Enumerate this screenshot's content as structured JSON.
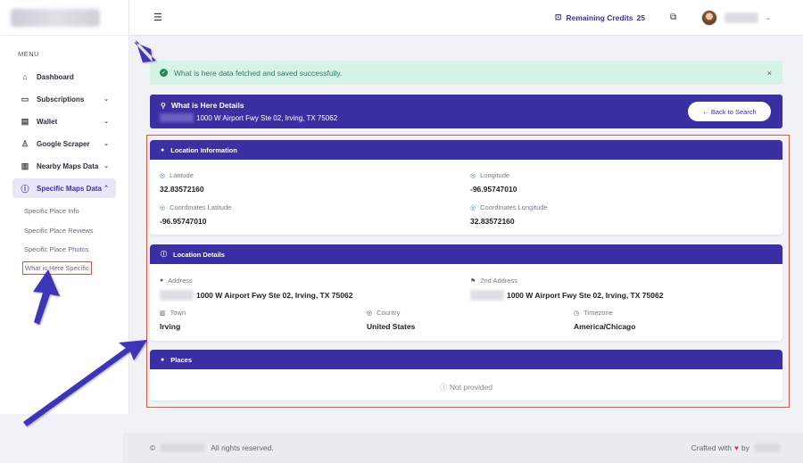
{
  "sidebar": {
    "menu_label": "MENU",
    "items": [
      {
        "label": "Dashboard",
        "icon": "home-icon",
        "glyph": "⌂",
        "chev": ""
      },
      {
        "label": "Subscriptions",
        "icon": "card-icon",
        "glyph": "▭",
        "chev": "⌄"
      },
      {
        "label": "Wallet",
        "icon": "wallet-icon",
        "glyph": "▤",
        "chev": "⌄"
      },
      {
        "label": "Google Scraper",
        "icon": "user-icon",
        "glyph": "♙",
        "chev": "⌄"
      },
      {
        "label": "Nearby Maps Data",
        "icon": "book-icon",
        "glyph": "▥",
        "chev": "⌄"
      },
      {
        "label": "Specific Maps Data",
        "icon": "info-icon",
        "glyph": "ⓘ",
        "chev": "⌃"
      }
    ],
    "sub_items": [
      "Specific Place Info",
      "Specific Place Reviews",
      "Specific Place Photos",
      "What is Here Specific"
    ]
  },
  "topbar": {
    "credits_label": "Remaining Credits",
    "credits_value": "25"
  },
  "alert": {
    "message": "What is here data fetched and saved successfully.",
    "close": "×"
  },
  "details": {
    "title": "What is Here Details",
    "address": "1000 W Airport Fwy Ste 02, Irving, TX 75062",
    "back_button": "← Back to Search"
  },
  "location_info": {
    "header": "Location Information",
    "latitude_label": "Latitude",
    "latitude_value": "32.83572160",
    "longitude_label": "Longitude",
    "longitude_value": "-96.95747010",
    "coord_lat_label": "Coordinates Latitude",
    "coord_lat_value": "-96.95747010",
    "coord_lng_label": "Coordinates Longitude",
    "coord_lng_value": "32.83572160"
  },
  "location_details": {
    "header": "Location Details",
    "address_label": "Address",
    "address_value": "1000 W Airport Fwy Ste 02, Irving, TX 75062",
    "address2_label": "2nd Address",
    "address2_value": "1000 W Airport Fwy Ste 02, Irving, TX 75062",
    "town_label": "Town",
    "town_value": "Irving",
    "country_label": "Country",
    "country_value": "United States",
    "timezone_label": "Timezone",
    "timezone_value": "America/Chicago"
  },
  "places": {
    "header": "Places",
    "empty": "Not provided"
  },
  "footer": {
    "copyright": "©",
    "rights": "All rights reserved.",
    "crafted": "Crafted with",
    "by": "by"
  },
  "colors": {
    "primary": "#3a2fa3",
    "success_bg": "#d6f3e8",
    "success_text": "#2f7d5b",
    "highlight_border": "#e0553b",
    "arrow": "#3d35b5"
  }
}
